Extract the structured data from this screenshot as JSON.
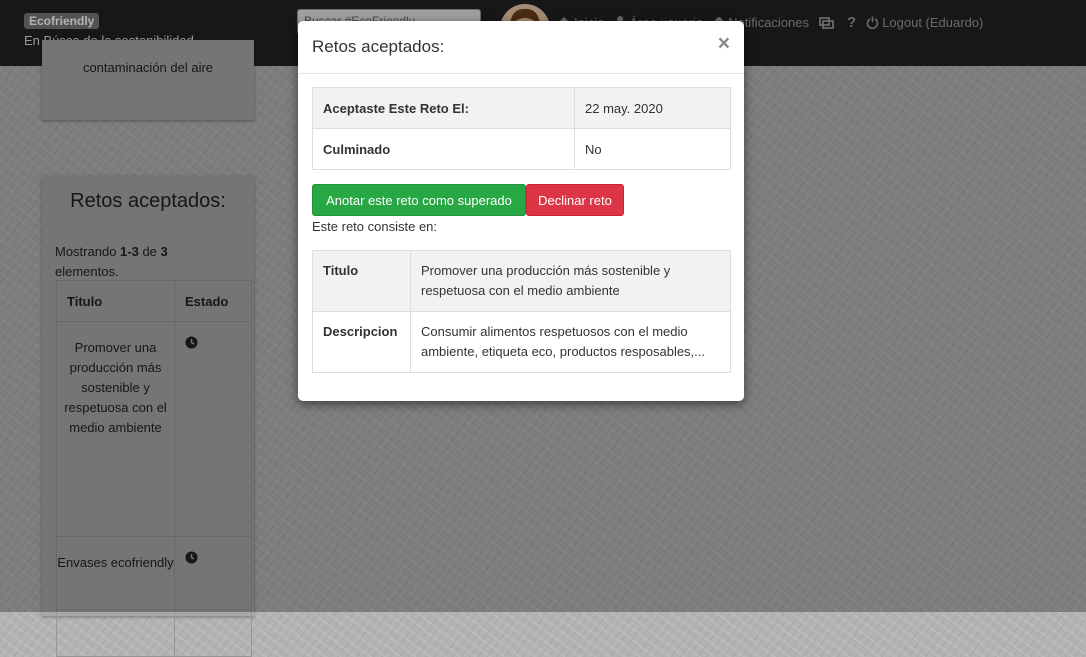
{
  "navbar": {
    "brand": "Ecofriendly",
    "subtitle": "En Búsca de la sostenibilidad",
    "search_value": "Buscar #EcoFriendly",
    "links": {
      "home": "Inicio",
      "user_area": "Área usuario",
      "notifications": "Notificaciones",
      "help": "?",
      "logout": "Logout (Eduardo)"
    }
  },
  "background": {
    "top_panel_text": "contaminación del aire",
    "retos_panel": {
      "title": "Retos aceptados:",
      "count_prefix": "Mostrando ",
      "count_range": "1-3",
      "count_mid": " de ",
      "count_total": "3",
      "count_suffix": "elementos.",
      "col_title": "Titulo",
      "col_state": "Estado",
      "rows": [
        {
          "title": "Promover una producción más sostenible y respetuosa con el medio ambiente"
        },
        {
          "title": "Envases ecofriendly"
        },
        {
          "title": ""
        }
      ]
    }
  },
  "modal": {
    "title": "Retos aceptados:",
    "close": "×",
    "accepted_label": "Aceptaste Este Reto El:",
    "accepted_date": "22 may. 2020",
    "completed_label": "Culminado",
    "completed_value": "No",
    "btn_complete": "Anotar este reto como superado",
    "btn_decline": "Declinar reto",
    "consists": "Este reto consiste en:",
    "detail_title_label": "Titulo",
    "detail_title_value": "Promover una producción más sostenible y respetuosa con el medio ambiente",
    "detail_desc_label": "Descripcion",
    "detail_desc_value": "Consumir alimentos respetuosos con el medio ambiente, etiqueta eco, productos resposables,..."
  },
  "colors": {
    "navbar": "#222222",
    "success": "#28a745",
    "danger": "#dc3545"
  },
  "icons": [
    "home-icon",
    "wrench-icon",
    "bell-icon",
    "inbox-icon",
    "question-icon",
    "power-icon",
    "clock-icon"
  ]
}
